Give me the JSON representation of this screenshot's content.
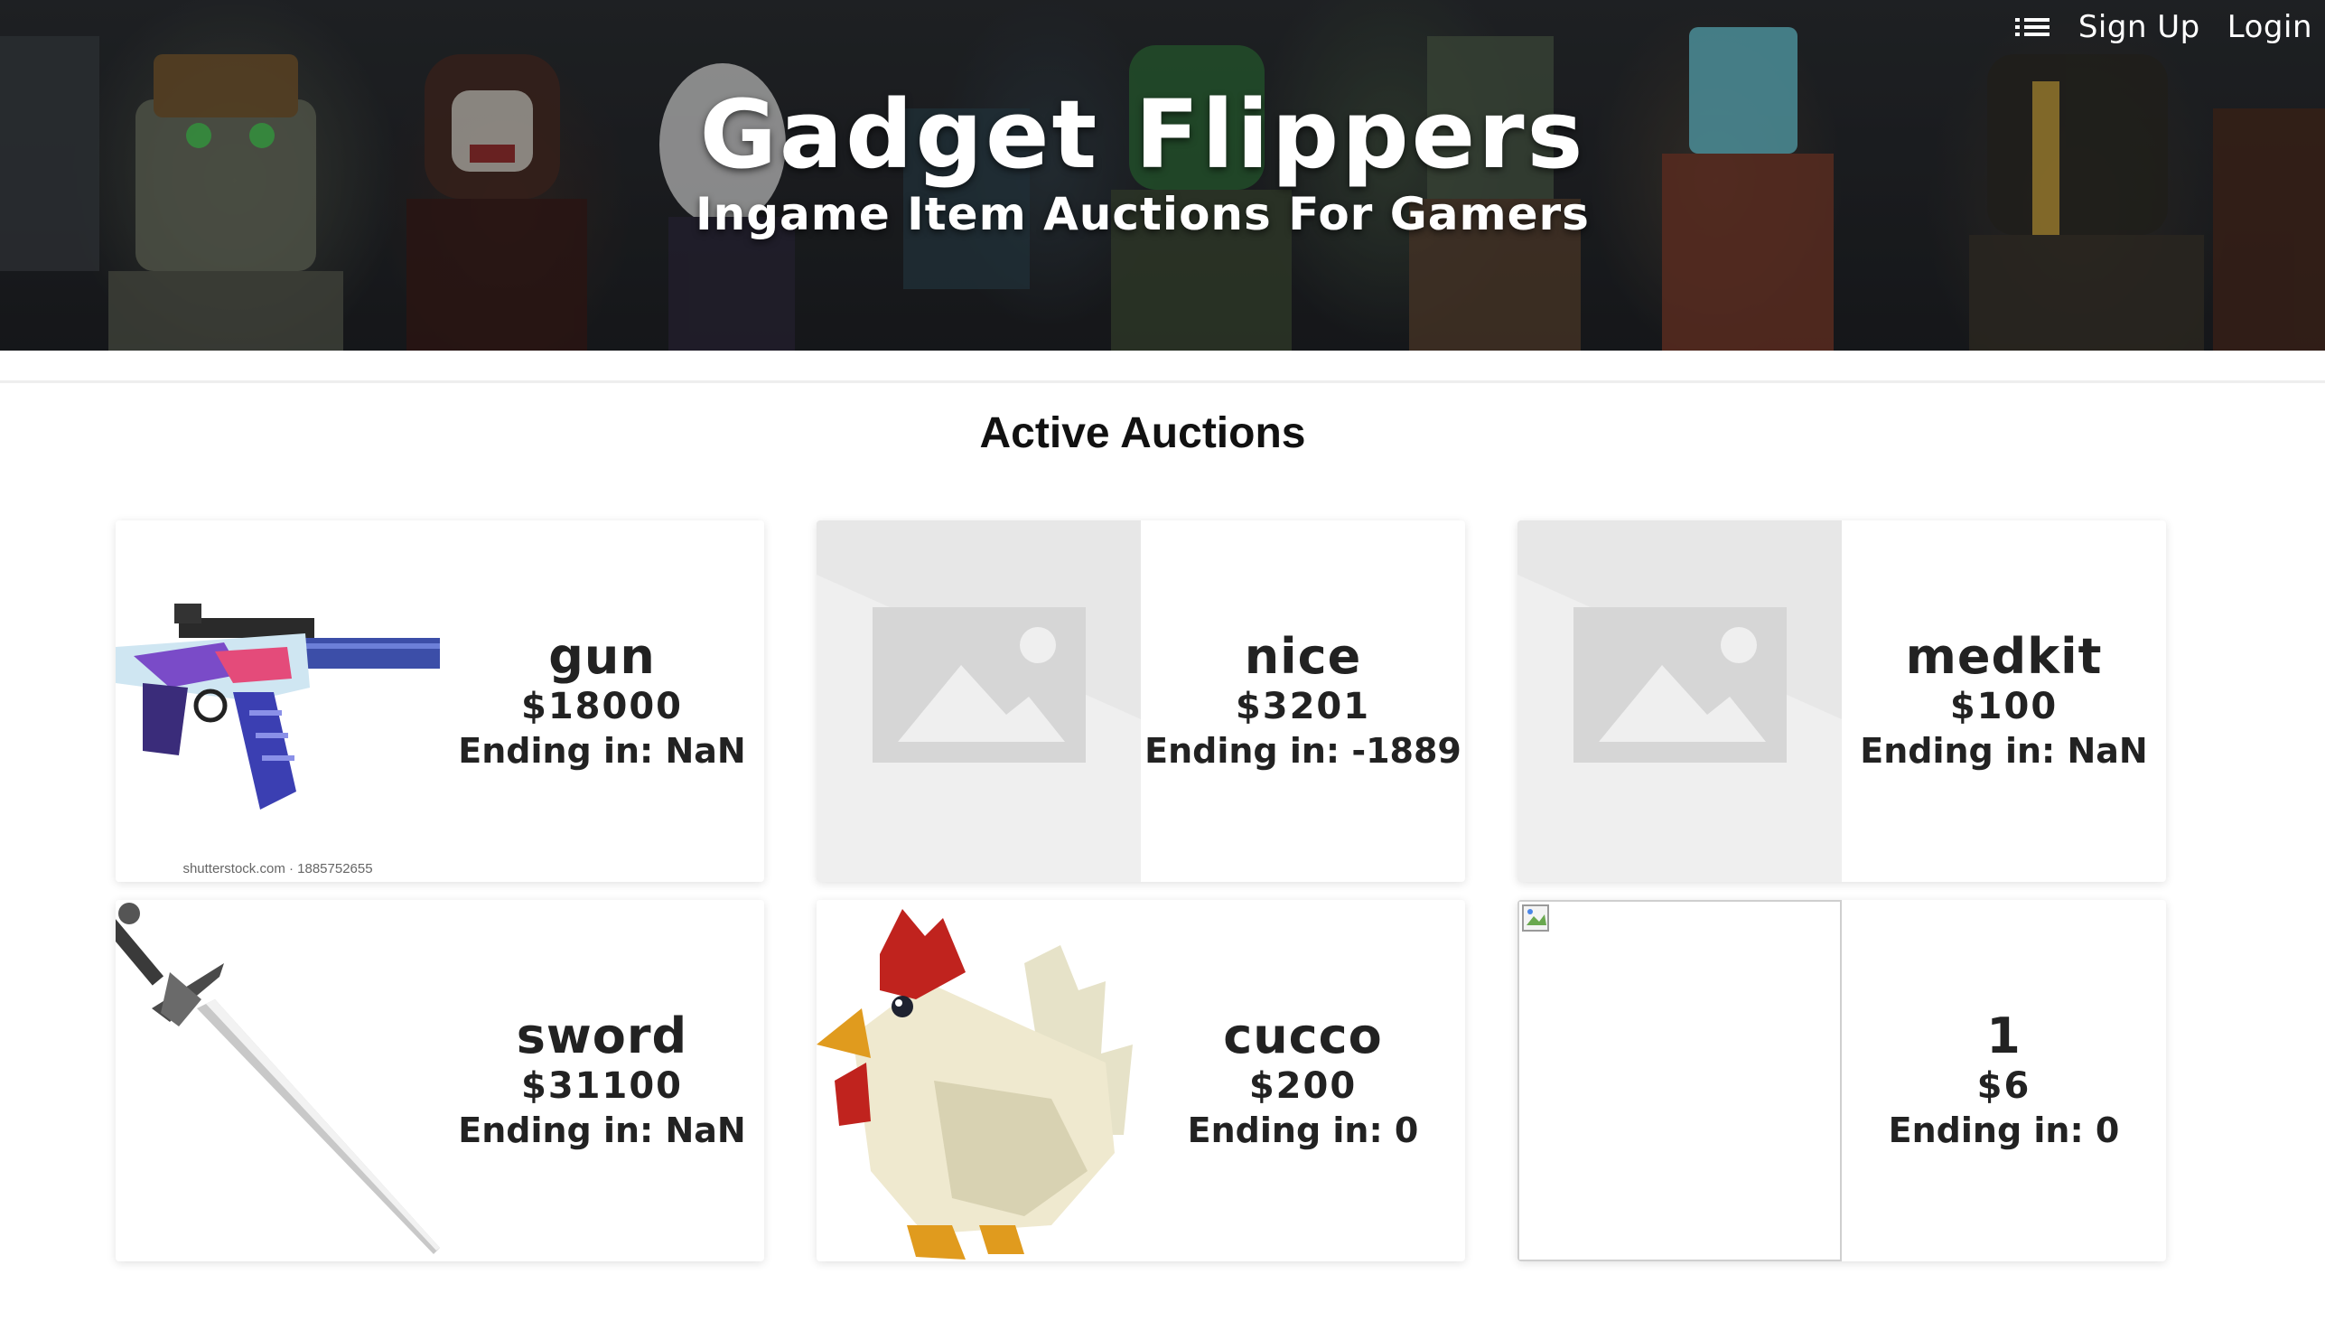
{
  "nav": {
    "signup_label": "Sign Up",
    "login_label": "Login"
  },
  "hero": {
    "title": "Gadget Flippers",
    "subtitle": "Ingame Item Auctions For Gamers"
  },
  "section": {
    "title": "Active Auctions"
  },
  "auctions": [
    {
      "name": "gun",
      "price": "$18000",
      "ending": "Ending in: NaN",
      "image": "rifle",
      "watermark": "shutterstock.com · 1885752655"
    },
    {
      "name": "nice",
      "price": "$3201",
      "ending": "Ending in: -1889",
      "image": "placeholder"
    },
    {
      "name": "medkit",
      "price": "$100",
      "ending": "Ending in: NaN",
      "image": "placeholder"
    },
    {
      "name": "sword",
      "price": "$31100",
      "ending": "Ending in: NaN",
      "image": "sword"
    },
    {
      "name": "cucco",
      "price": "$200",
      "ending": "Ending in: 0",
      "image": "chicken"
    },
    {
      "name": "1",
      "price": "$6",
      "ending": "Ending in: 0",
      "image": "broken-image"
    }
  ]
}
